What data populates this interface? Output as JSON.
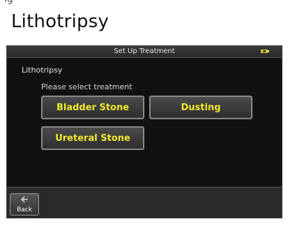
{
  "page": {
    "top_fragment": "ig",
    "heading": "Lithotripsy"
  },
  "screen": {
    "title": "Set Up Treatment",
    "section_label": "Lithotripsy",
    "prompt": "Please select treatment",
    "treatments": [
      "Bladder Stone",
      "Dusting",
      "Ureteral Stone"
    ],
    "back_label": "Back",
    "colors": {
      "background": "#111111",
      "button_text": "#f2ea2a",
      "button_border": "#8a8a8a",
      "battery_icon": "#e2d23a"
    },
    "icons": [
      "battery-icon",
      "back-arrow-icon"
    ]
  }
}
